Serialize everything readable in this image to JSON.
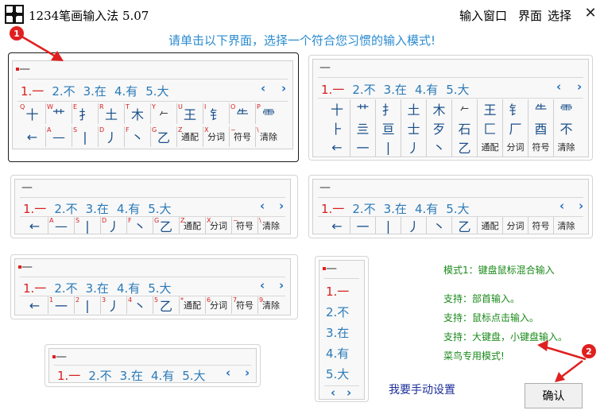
{
  "window": {
    "title": "1234笔画输入法 5.07",
    "menu": [
      "输入窗口",
      "界面",
      "选择"
    ],
    "close": "✕"
  },
  "instruction": "请单击以下界面，选择一个符合您习惯的输入模式!",
  "composition": "—",
  "candidates": [
    "1.一",
    "2.不",
    "3.在",
    "4.有",
    "5.大"
  ],
  "pager": {
    "prev": "‹",
    "next": "›"
  },
  "layout1": {
    "row1_hints": [
      "Q",
      "W",
      "E",
      "R",
      "T",
      "Y",
      "U",
      "I",
      "O",
      "P"
    ],
    "row1_glyphs": [
      "十",
      "艹",
      "扌",
      "土",
      "木",
      "𠂉",
      "王",
      "钅",
      "⺧",
      "⻗"
    ],
    "row2_hints": [
      "",
      "A",
      "S",
      "D",
      "F",
      "G",
      "Z",
      "X",
      "~",
      "\\"
    ],
    "row2_glyphs": [
      "←",
      "—",
      "|",
      "丿",
      "丶",
      "乙",
      "通配",
      "分词",
      "符号",
      "清除"
    ]
  },
  "layout2": {
    "row1_glyphs": [
      "十",
      "艹",
      "扌",
      "土",
      "木",
      "𠂉",
      "王",
      "钅",
      "⺧",
      "⻗"
    ],
    "row2_glyphs": [
      "⺊",
      "亖",
      "亘",
      "士",
      "歹",
      "石",
      "匚",
      "厂",
      "酉",
      "不"
    ],
    "row3_glyphs": [
      "←",
      "一",
      "|",
      "丿",
      "丶",
      "乙",
      "通配",
      "分词",
      "符号",
      "清除"
    ]
  },
  "layout3": {
    "row_hints": [
      "",
      "A",
      "S",
      "D",
      "F",
      "G",
      "Z",
      "X",
      "~",
      "\\"
    ],
    "row_glyphs": [
      "←",
      "—",
      "|",
      "丿",
      "丶",
      "乙",
      "通配",
      "分词",
      "符号",
      "清除"
    ]
  },
  "layout4": {
    "row_glyphs": [
      "←",
      "一",
      "|",
      "丿",
      "丶",
      "乙",
      "通配",
      "分词",
      "符号",
      "清除"
    ]
  },
  "layout5": {
    "row_hints": [
      "",
      "1",
      "2",
      "3",
      "4",
      "5",
      "*",
      "6",
      "7",
      "9"
    ],
    "row_glyphs": [
      "←",
      "一",
      "|",
      "丿",
      "丶",
      "乙",
      "通配",
      "分词",
      "符号",
      "清除"
    ]
  },
  "vertical_candidates": [
    "1.一",
    "2.不",
    "3.在",
    "4.有",
    "5.大"
  ],
  "mode_info": {
    "mode": "模式1：键盘鼠标混合输入",
    "support1": "支持：部首输入。",
    "support2": "支持：鼠标点击输入。",
    "support3": "支持：大键盘，小键盘输入。",
    "rookie": "菜鸟专用模式!"
  },
  "manual_setup": "我要手动设置",
  "ok_button": "确认",
  "annotations": [
    "1",
    "2"
  ],
  "colors": {
    "accent_blue": "#2a8bd0",
    "first_candidate_red": "#d81e1e",
    "mode_text_green": "#1a8a1a",
    "annotation_red": "#e02020"
  }
}
